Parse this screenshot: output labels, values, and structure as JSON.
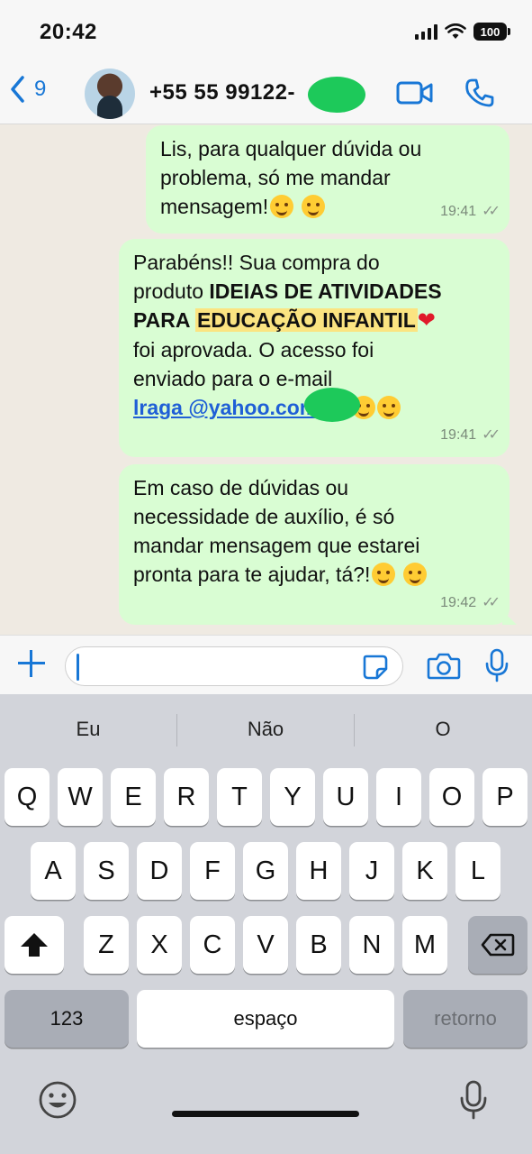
{
  "status": {
    "time": "20:42",
    "battery": "100"
  },
  "header": {
    "back_count": "9",
    "contact": "+55 55 99122-"
  },
  "messages": [
    {
      "line1": "Lis, para qualquer dúvida ou",
      "line2": "problema, só me mandar",
      "line3": "mensagem!",
      "time": "19:41"
    },
    {
      "line1": "Parabéns!! Sua compra do",
      "line2_pre": "produto ",
      "line2_bold": "IDEIAS DE ATIVIDADES",
      "line3_pre": "PARA ",
      "line3_hl": "EDUCAÇÃO INFANTIL",
      "line4": "foi aprovada. O acesso foi",
      "line5": "enviado para o e-mail",
      "email": "lraga                @yahoo.com.br",
      "email_end": ".",
      "time": "19:41"
    },
    {
      "line1": "Em caso de dúvidas ou",
      "line2": "necessidade de auxílio, é só",
      "line3": "mandar mensagem que estarei",
      "line4": "pronta para te ajudar, tá?!",
      "time": "19:42"
    }
  ],
  "composer": {
    "value": "",
    "placeholder": ""
  },
  "keyboard": {
    "suggestions": [
      "Eu",
      "Não",
      "O"
    ],
    "row1": [
      "Q",
      "W",
      "E",
      "R",
      "T",
      "Y",
      "U",
      "I",
      "O",
      "P"
    ],
    "row2": [
      "A",
      "S",
      "D",
      "F",
      "G",
      "H",
      "J",
      "K",
      "L"
    ],
    "row3": [
      "Z",
      "X",
      "C",
      "V",
      "B",
      "N",
      "M"
    ],
    "numbers": "123",
    "space": "espaço",
    "return": "retorno"
  },
  "icons": {
    "back": "chevron-left-icon",
    "video": "video-call-icon",
    "call": "phone-icon",
    "plus": "plus-icon",
    "sticker": "sticker-icon",
    "camera": "camera-icon",
    "mic": "microphone-icon",
    "shift": "shift-icon",
    "delete": "backspace-icon",
    "emoji": "emoji-icon",
    "read": "double-check-icon"
  },
  "colors": {
    "accent": "#1877d6",
    "bubble": "#d9fdd3",
    "highlight": "#fbe481",
    "link": "#1f5fd6",
    "redaction": "#1dc95a"
  }
}
